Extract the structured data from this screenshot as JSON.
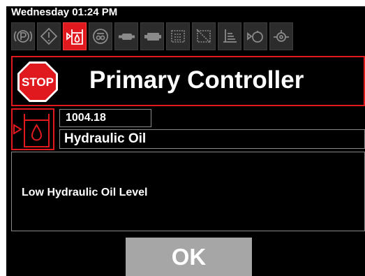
{
  "status_bar": {
    "datetime": "Wednesday 01:24 PM"
  },
  "icon_bar": {
    "buttons": [
      {
        "icon": "parking-brake-icon",
        "active": false
      },
      {
        "icon": "warning-icon",
        "active": false
      },
      {
        "icon": "hydraulic-oil-icon",
        "active": true
      },
      {
        "icon": "engine-icon",
        "active": false
      },
      {
        "icon": "transmission-icon",
        "active": false
      },
      {
        "icon": "battery-icon",
        "active": false
      },
      {
        "icon": "coolant-icon",
        "active": false
      },
      {
        "icon": "filter-icon",
        "active": false
      },
      {
        "icon": "fuel-icon",
        "active": false
      },
      {
        "icon": "oil-pressure-icon",
        "active": false
      },
      {
        "icon": "oil-temperature-icon",
        "active": false
      }
    ]
  },
  "header": {
    "stop_label": "STOP",
    "title": "Primary Controller"
  },
  "fault": {
    "icon": "hydraulic-oil-icon",
    "code": "1004.18",
    "name": "Hydraulic Oil",
    "message": "Low Hydraulic Oil Level"
  },
  "ok_button": {
    "label": "OK"
  },
  "colors": {
    "alert_red": "#e0191e",
    "ok_gray": "#a6a6a6",
    "background": "#000000"
  }
}
